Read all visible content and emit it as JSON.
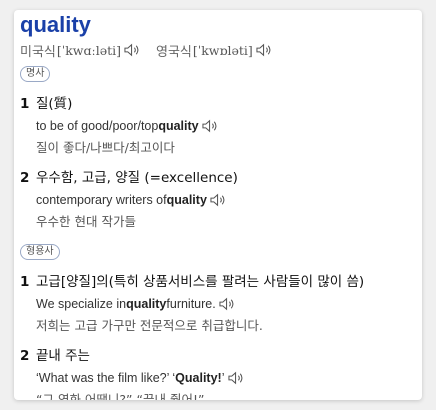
{
  "headword": "quality",
  "pronunciations": [
    {
      "label": "미국식",
      "ipa": "[ˈkwɑːləti]"
    },
    {
      "label": "영국식",
      "ipa": "[ˈkwɒləti]"
    }
  ],
  "sections": [
    {
      "pos": "명사",
      "senses": [
        {
          "num": "1",
          "definition": "질(質)",
          "example_parts": [
            "to be of good/poor/top ",
            "quality",
            ""
          ],
          "translation": "질이 좋다/나쁘다/최고이다"
        },
        {
          "num": "2",
          "definition": "우수함, 고급, 양질 (=excellence)",
          "example_parts": [
            "contemporary writers of ",
            "quality",
            ""
          ],
          "translation": "우수한 현대 작가들"
        }
      ]
    },
    {
      "pos": "형용사",
      "senses": [
        {
          "num": "1",
          "definition": "고급[양질]의(특히 상품서비스를 팔려는 사람들이 많이 씀)",
          "example_parts": [
            "We specialize in ",
            "quality",
            " furniture."
          ],
          "translation": "저희는 고급 가구만 전문적으로 취급합니다."
        },
        {
          "num": "2",
          "definition": "끝내 주는",
          "example_parts": [
            "‘What was the film like?’ ‘",
            "Quality!",
            "’"
          ],
          "translation": "“그 영화 어땠니?” “끝내 줬어!”"
        }
      ]
    }
  ],
  "icons": {
    "speaker": "speaker-icon"
  },
  "colors": {
    "headword": "#1a40a8",
    "badge_border": "#9aa9c6"
  }
}
